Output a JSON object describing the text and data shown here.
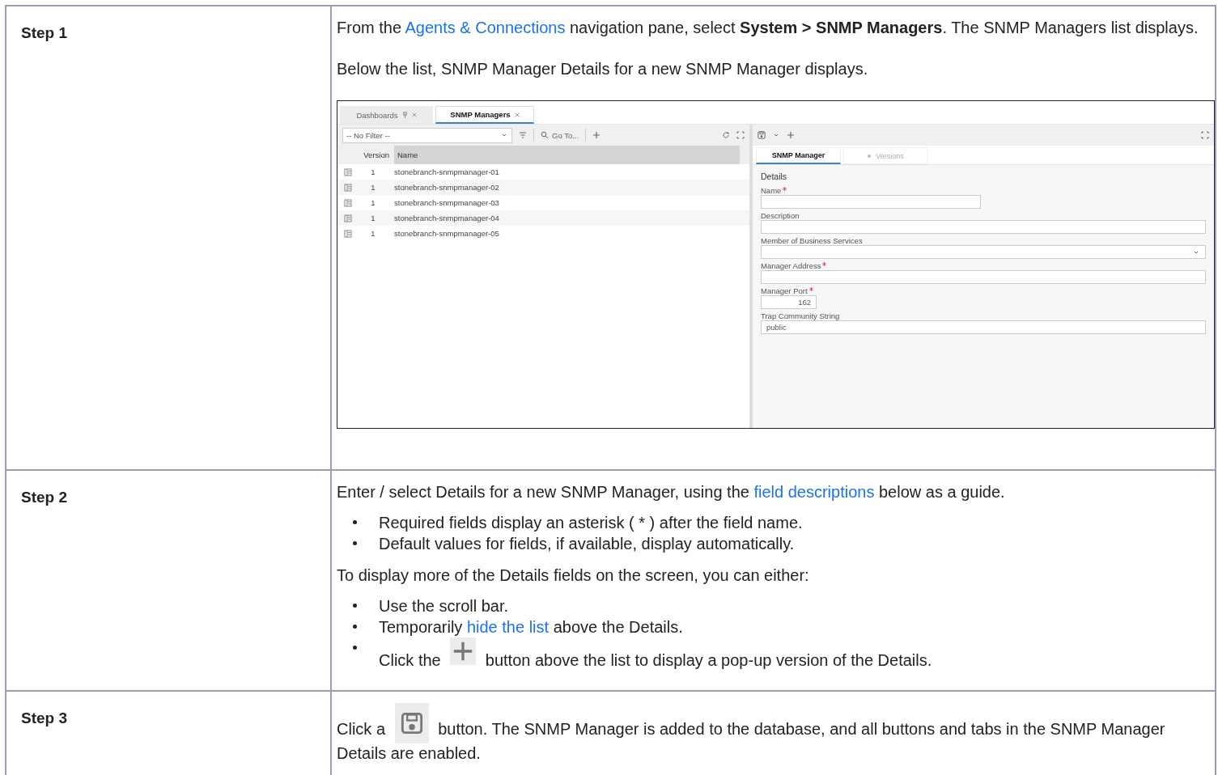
{
  "steps": [
    {
      "label": "Step 1",
      "blocks": [
        {
          "kind": "para",
          "parts": [
            {
              "kind": "text",
              "text": "From the "
            },
            {
              "kind": "link",
              "text": "Agents & Connections"
            },
            {
              "kind": "text",
              "text": " navigation pane, select **System > SNMP Managers**. The SNMP Managers list displays."
            }
          ]
        },
        {
          "kind": "para",
          "parts": [
            {
              "kind": "text",
              "text": "Below the list, SNMP Manager Details for a new SNMP Manager displays."
            }
          ]
        },
        {
          "kind": "screenshot"
        }
      ]
    },
    {
      "label": "Step 2",
      "blocks": [
        {
          "kind": "para",
          "parts": [
            {
              "kind": "text",
              "text": "Enter / select Details for a new SNMP Manager, using the "
            },
            {
              "kind": "link",
              "text": "field descriptions"
            },
            {
              "kind": "text",
              "text": " below as a guide."
            }
          ]
        },
        {
          "kind": "bullets",
          "items": [
            {
              "parts": [
                {
                  "kind": "text",
                  "text": "Required fields display an asterisk ( * ) after the field name."
                }
              ]
            },
            {
              "parts": [
                {
                  "kind": "text",
                  "text": "Default values for fields, if available, display automatically."
                }
              ]
            }
          ]
        },
        {
          "kind": "para",
          "parts": [
            {
              "kind": "text",
              "text": "To display more of the Details fields on the screen, you can either:"
            }
          ]
        },
        {
          "kind": "bullets",
          "items": [
            {
              "parts": [
                {
                  "kind": "text",
                  "text": "Use the scroll bar."
                }
              ]
            },
            {
              "parts": [
                {
                  "kind": "text",
                  "text": "Temporarily "
                },
                {
                  "kind": "link",
                  "text": "hide the list"
                },
                {
                  "kind": "text",
                  "text": " above the Details."
                }
              ]
            },
            {
              "parts": [
                {
                  "kind": "text",
                  "text": "Click the "
                },
                {
                  "kind": "plus"
                },
                {
                  "kind": "text",
                  "text": " button above the list to display a pop-up version of the Details."
                }
              ]
            }
          ]
        }
      ]
    },
    {
      "label": "Step 3",
      "blocks": [
        {
          "kind": "para",
          "parts": [
            {
              "kind": "text",
              "text": "Click a "
            },
            {
              "kind": "save"
            },
            {
              "kind": "text",
              "text": " button. The SNMP Manager is added to the database, and all buttons and tabs in the SNMP Manager Details are enabled."
            }
          ]
        }
      ]
    }
  ],
  "screenshot": {
    "tabs": [
      {
        "label": "Dashboards",
        "pinned": true,
        "selected": false
      },
      {
        "label": "SNMP Managers",
        "pinned": false,
        "selected": true
      }
    ],
    "filter": {
      "value": "-- No Filter --"
    },
    "goto": "Go To...",
    "columns": [
      "Version",
      "Name"
    ],
    "rows": [
      {
        "version": "1",
        "name": "stonebranch-snmpmanager-01"
      },
      {
        "version": "1",
        "name": "stonebranch-snmpmanager-02"
      },
      {
        "version": "1",
        "name": "stonebranch-snmpmanager-03"
      },
      {
        "version": "1",
        "name": "stonebranch-snmpmanager-04"
      },
      {
        "version": "1",
        "name": "stonebranch-snmpmanager-05"
      }
    ],
    "detail_tabs": [
      {
        "label": "SNMP Manager",
        "selected": true
      },
      {
        "label": "Versions",
        "selected": false
      }
    ],
    "section": "Details",
    "fields": [
      {
        "label": "Name",
        "required": true,
        "kind": "short-text"
      },
      {
        "label": "Description",
        "required": false,
        "kind": "text"
      },
      {
        "label": "Member of Business Services",
        "required": false,
        "kind": "select"
      },
      {
        "label": "Manager Address",
        "required": true,
        "kind": "text"
      },
      {
        "label": "Manager Port",
        "required": true,
        "kind": "number",
        "value": "162"
      },
      {
        "label": "Trap Community String",
        "required": false,
        "kind": "text",
        "value": "public"
      }
    ]
  }
}
